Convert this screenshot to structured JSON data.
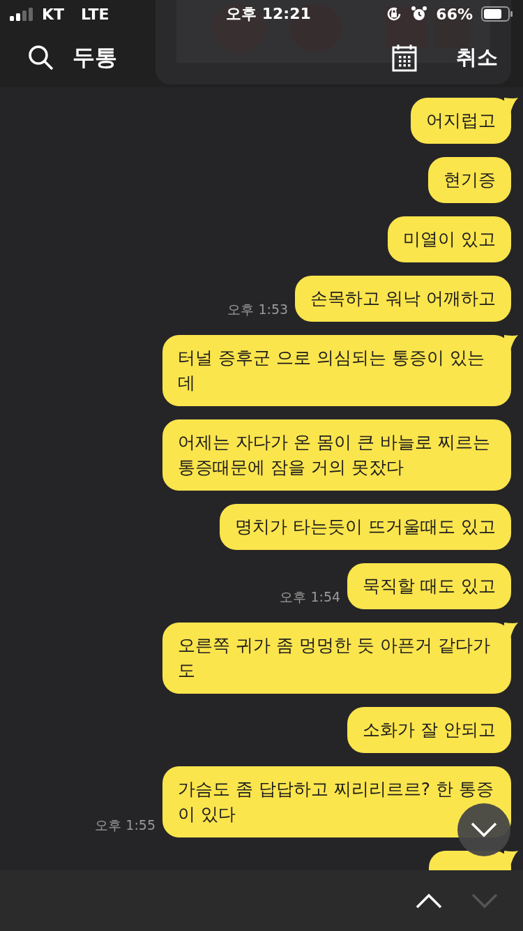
{
  "status_bar": {
    "carrier": "KT",
    "network": "LTE",
    "time": "오후 12:21",
    "battery_percent": "66%"
  },
  "search_bar": {
    "query": "두통",
    "cancel": "취소"
  },
  "messages": [
    {
      "kind": "picture"
    },
    {
      "kind": "text",
      "text": "어지럽고",
      "tail": true
    },
    {
      "kind": "text",
      "text": "현기증",
      "tail": false
    },
    {
      "kind": "text",
      "text": "미열이 있고",
      "tail": false
    },
    {
      "kind": "text",
      "text": "손목하고 워낙 어깨하고",
      "tail": false,
      "time": "오후 1:53"
    },
    {
      "kind": "text",
      "text": "터널 증후군 으로 의심되는 통증이 있는데",
      "tail": true
    },
    {
      "kind": "text",
      "text": "어제는 자다가 온 몸이 큰 바늘로 찌르는 통증때문에 잠을 거의 못잤다",
      "tail": false
    },
    {
      "kind": "text",
      "text": "명치가 타는듯이 뜨거울때도 있고",
      "tail": false
    },
    {
      "kind": "text",
      "text": "묵직할 때도 있고",
      "tail": false,
      "time": "오후 1:54"
    },
    {
      "kind": "text",
      "text": "오른쪽 귀가 좀 멍멍한 듯 아픈거 같다가도",
      "tail": true
    },
    {
      "kind": "text",
      "text": "소화가 잘 안되고",
      "tail": false
    },
    {
      "kind": "text",
      "text": "가슴도 좀 답답하고 찌리리르르? 한 통증이 있다",
      "tail": false,
      "time": "오후 1:55"
    },
    {
      "kind": "cut_bubble",
      "tail": true
    }
  ],
  "result_nav": {
    "previous_disabled": false,
    "next_disabled": true
  }
}
